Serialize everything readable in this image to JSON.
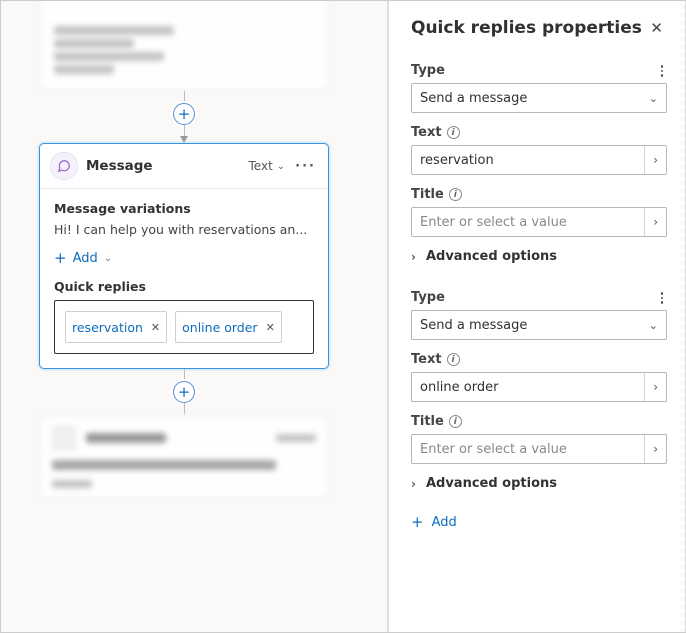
{
  "canvas": {
    "node": {
      "title": "Message",
      "type_label": "Text",
      "variations_label": "Message variations",
      "message_preview": "Hi! I can help you with reservations an...",
      "add_label": "Add",
      "quick_replies_label": "Quick replies",
      "chips": [
        {
          "label": "reservation"
        },
        {
          "label": "online order"
        }
      ]
    }
  },
  "panel": {
    "title": "Quick replies properties",
    "type_label": "Type",
    "text_label": "Text",
    "title_label": "Title",
    "title_placeholder": "Enter or select a value",
    "advanced_label": "Advanced options",
    "add_label": "Add",
    "items": [
      {
        "type_value": "Send a message",
        "text_value": "reservation",
        "title_value": ""
      },
      {
        "type_value": "Send a message",
        "text_value": "online order",
        "title_value": ""
      }
    ]
  }
}
